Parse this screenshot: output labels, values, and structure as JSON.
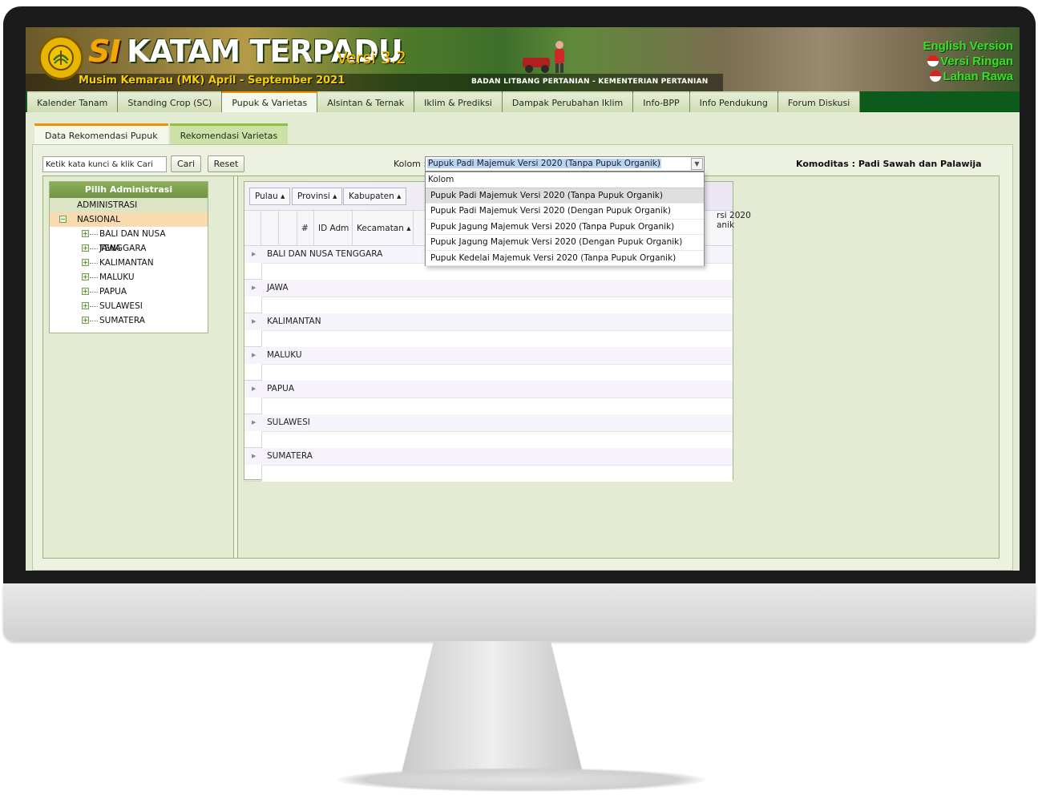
{
  "header": {
    "title_prefix": "SI",
    "title_main": "KATAM TERPADU",
    "version": "Versi 3.2",
    "season": "Musim Kemarau (MK) April - September 2021",
    "agency": "BADAN LITBANG PERTANIAN - KEMENTERIAN PERTANIAN",
    "links": [
      "English Version",
      "Versi Ringan",
      "Lahan Rawa"
    ]
  },
  "menu": {
    "items": [
      "Kalender Tanam",
      "Standing Crop (SC)",
      "Pupuk & Varietas",
      "Alsintan & Ternak",
      "Iklim & Prediksi",
      "Dampak Perubahan Iklim",
      "Info-BPP",
      "Info Pendukung",
      "Forum Diskusi"
    ],
    "active": "Pupuk & Varietas"
  },
  "subtabs": {
    "items": [
      "Data Rekomendasi Pupuk",
      "Rekomendasi Varietas"
    ],
    "active": "Data Rekomendasi Pupuk"
  },
  "toolbar": {
    "search_placeholder": "Ketik kata kunci & klik Cari",
    "cari_label": "Cari",
    "reset_label": "Reset",
    "kolom_label": "Kolom :",
    "kolom_selected": "Pupuk Padi Majemuk Versi 2020 (Tanpa Pupuk Organik)",
    "komoditas": "Komoditas : Padi Sawah dan Palawija"
  },
  "dropdown": {
    "header": "Kolom",
    "options": [
      "Pupuk Padi Majemuk Versi 2020 (Tanpa Pupuk Organik)",
      "Pupuk Padi Majemuk Versi 2020 (Dengan Pupuk Organik)",
      "Pupuk Jagung Majemuk Versi 2020 (Tanpa Pupuk Organik)",
      "Pupuk Jagung Majemuk Versi 2020 (Dengan Pupuk Organik)",
      "Pupuk Kedelai Majemuk Versi 2020 (Tanpa Pupuk Organik)"
    ],
    "highlighted": "Pupuk Padi Majemuk Versi 2020 (Tanpa Pupuk Organik)",
    "clipped_header_tail_1": "rsi 2020",
    "clipped_header_tail_2": "anik"
  },
  "tree": {
    "title": "Pilih Administrasi",
    "admin_label": "ADMINISTRASI",
    "root": "NASIONAL",
    "regions": [
      "BALI DAN NUSA TENGGARA",
      "JAWA",
      "KALIMANTAN",
      "MALUKU",
      "PAPUA",
      "SULAWESI",
      "SUMATERA"
    ]
  },
  "grid": {
    "group_chips": [
      "Pulau ▴",
      "Provinsi ▴",
      "Kabupaten ▴"
    ],
    "columns": [
      "#",
      "ID Adm",
      "Kecamatan ▴"
    ],
    "groups": [
      "BALI DAN NUSA TENGGARA",
      "JAWA",
      "KALIMANTAN",
      "MALUKU",
      "PAPUA",
      "SULAWESI",
      "SUMATERA"
    ]
  },
  "colors": {
    "menu_bg": "#0c5a1c",
    "active_accent": "#f29000",
    "link_green": "#3cdc2a",
    "panel_bg": "#e3ebd3"
  }
}
